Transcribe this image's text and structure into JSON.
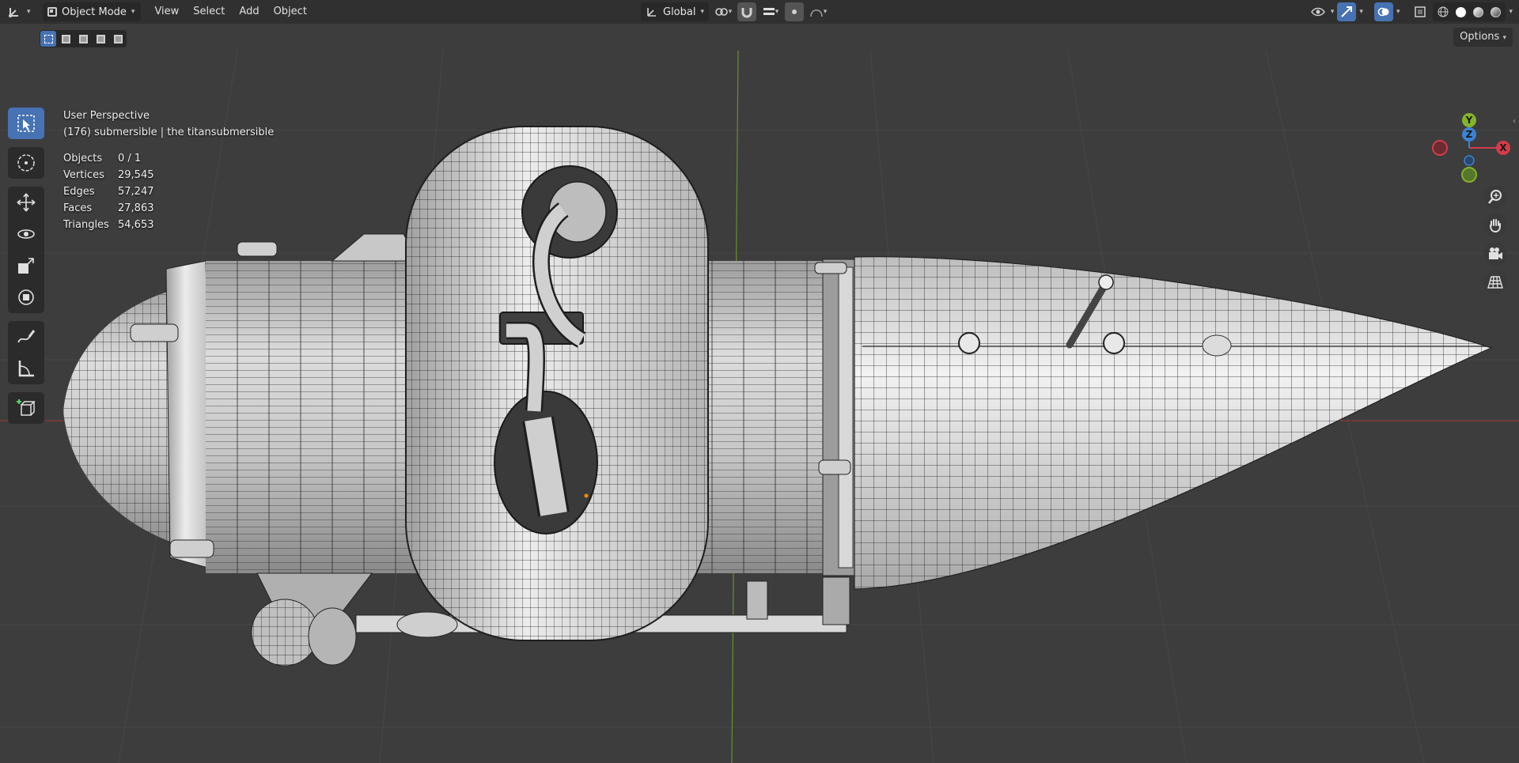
{
  "header": {
    "mode": "Object Mode",
    "menus": [
      "View",
      "Select",
      "Add",
      "Object"
    ],
    "orientation": "Global"
  },
  "subheader": {
    "options_label": "Options"
  },
  "overlay": {
    "perspective": "User Perspective",
    "collection_info": "(176) submersible | the titansubmersible",
    "stats": {
      "objects_label": "Objects",
      "objects_value": "0 / 1",
      "vertices_label": "Vertices",
      "vertices_value": "29,545",
      "edges_label": "Edges",
      "edges_value": "57,247",
      "faces_label": "Faces",
      "faces_value": "27,863",
      "triangles_label": "Triangles",
      "triangles_value": "54,653"
    }
  },
  "gizmo": {
    "x_label": "X",
    "y_label": "Y",
    "z_label": "Z",
    "x_color": "#d33c4b",
    "y_color": "#82b42a",
    "z_color": "#3c82d3"
  },
  "colors": {
    "accent": "#4772b3",
    "viewport_bg": "#3d3d3d",
    "header_bg": "#303030"
  },
  "icons": {
    "toolbar": [
      "select-box-icon",
      "cursor-icon",
      "move-icon",
      "rotate-icon",
      "scale-icon",
      "transform-icon",
      "annotate-icon",
      "measure-icon",
      "add-cube-icon"
    ],
    "nav": [
      "zoom-icon",
      "hand-pan-icon",
      "camera-icon",
      "grid-perspective-icon"
    ]
  }
}
